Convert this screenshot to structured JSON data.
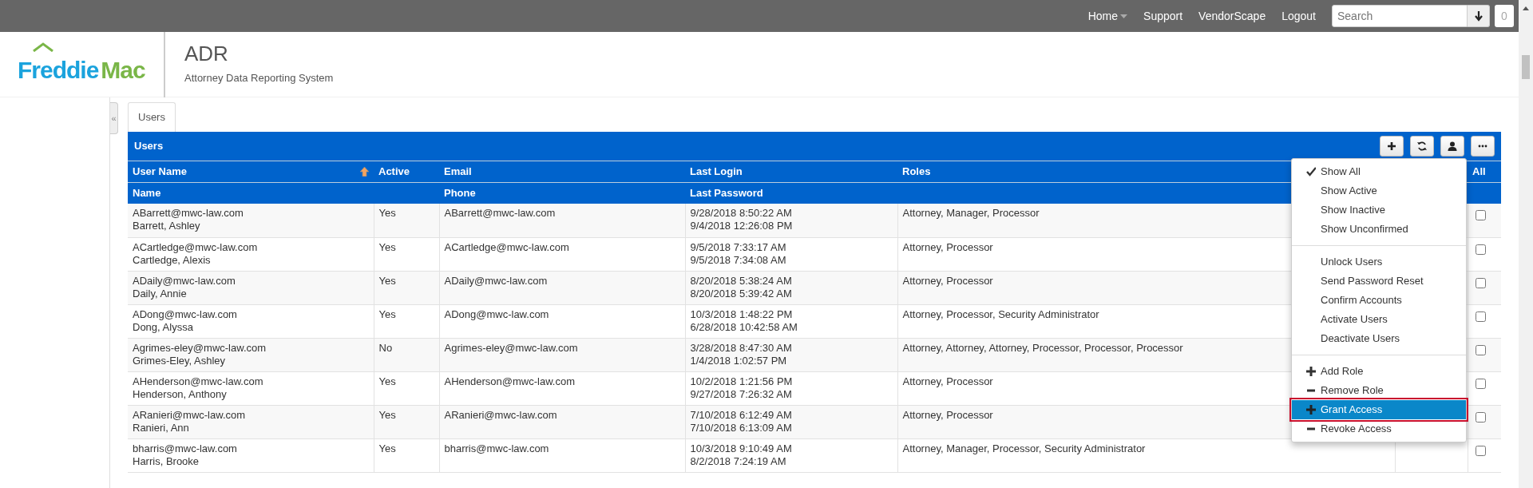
{
  "top_nav": {
    "links": [
      {
        "label": "Home",
        "has_caret": true
      },
      {
        "label": "Support",
        "has_caret": false
      },
      {
        "label": "VendorScape",
        "has_caret": false
      },
      {
        "label": "Logout",
        "has_caret": false
      }
    ],
    "search": {
      "placeholder": "Search"
    },
    "badge": "0"
  },
  "header": {
    "logo": [
      "Freddie",
      "Mac"
    ],
    "title": "ADR",
    "subtitle": "Attorney Data Reporting System"
  },
  "sidebar_toggle": "«",
  "tabs": [
    {
      "label": "Users",
      "selected": true
    }
  ],
  "panel": {
    "title": "Users",
    "toolbar": [
      {
        "kind": "plus"
      },
      {
        "kind": "refresh"
      },
      {
        "kind": "user"
      },
      {
        "kind": "more"
      }
    ]
  },
  "table": {
    "columns": [
      {
        "label": "User Name",
        "sorted_ascending": true
      },
      {
        "label": "Active"
      },
      {
        "label": "Email"
      },
      {
        "label": "Last Login"
      },
      {
        "label": "Roles"
      },
      {},
      {
        "label": "All"
      }
    ],
    "sub_columns": [
      "Name",
      "",
      "Phone",
      "Last Password"
    ],
    "rows": [
      {
        "user_name": "ABarrett@mwc-law.com",
        "name": "Barrett, Ashley",
        "active": "Yes",
        "email": "ABarrett@mwc-law.com",
        "last_login": "9/28/2018 8:50:22 AM",
        "last_password": "9/4/2018 12:26:08 PM",
        "roles": "Attorney, Manager, Processor",
        "checked": false
      },
      {
        "user_name": "ACartledge@mwc-law.com",
        "name": "Cartledge, Alexis",
        "active": "Yes",
        "email": "ACartledge@mwc-law.com",
        "last_login": "9/5/2018 7:33:17 AM",
        "last_password": "9/5/2018 7:34:08 AM",
        "roles": "Attorney, Processor",
        "checked": false
      },
      {
        "user_name": "ADaily@mwc-law.com",
        "name": "Daily, Annie",
        "active": "Yes",
        "email": "ADaily@mwc-law.com",
        "last_login": "8/20/2018 5:38:24 AM",
        "last_password": "8/20/2018 5:39:42 AM",
        "roles": "Attorney, Processor",
        "checked": false
      },
      {
        "user_name": "ADong@mwc-law.com",
        "name": "Dong, Alyssa",
        "active": "Yes",
        "email": "ADong@mwc-law.com",
        "last_login": "10/3/2018 1:48:22 PM",
        "last_password": "6/28/2018 10:42:58 AM",
        "roles": "Attorney, Processor, Security Administrator",
        "checked": false
      },
      {
        "user_name": "Agrimes-eley@mwc-law.com",
        "name": "Grimes-Eley, Ashley",
        "active": "No",
        "email": "Agrimes-eley@mwc-law.com",
        "last_login": "3/28/2018 8:47:30 AM",
        "last_password": "1/4/2018 1:02:57 PM",
        "roles": "Attorney, Attorney, Attorney, Processor, Processor, Processor",
        "checked": false
      },
      {
        "user_name": "AHenderson@mwc-law.com",
        "name": "Henderson, Anthony",
        "active": "Yes",
        "email": "AHenderson@mwc-law.com",
        "last_login": "10/2/2018 1:21:56 PM",
        "last_password": "9/27/2018 7:26:32 AM",
        "roles": "Attorney, Processor",
        "checked": false
      },
      {
        "user_name": "ARanieri@mwc-law.com",
        "name": "Ranieri, Ann",
        "active": "Yes",
        "email": "ARanieri@mwc-law.com",
        "last_login": "7/10/2018 6:12:49 AM",
        "last_password": "7/10/2018 6:13:09 AM",
        "roles": "Attorney, Processor",
        "checked": false
      },
      {
        "user_name": "bharris@mwc-law.com",
        "name": "Harris, Brooke",
        "active": "Yes",
        "email": "bharris@mwc-law.com",
        "last_login": "10/3/2018 9:10:49 AM",
        "last_password": "8/2/2018 7:24:19 AM",
        "roles": "Attorney, Manager, Processor, Security Administrator",
        "checked": false
      }
    ]
  },
  "menu": {
    "groups": [
      [
        {
          "label": "Show All",
          "kind": "check",
          "checked": true,
          "selected": false
        },
        {
          "label": "Show Active",
          "kind": "check",
          "checked": false,
          "selected": false
        },
        {
          "label": "Show Inactive",
          "kind": "check",
          "checked": false,
          "selected": false
        },
        {
          "label": "Show Unconfirmed",
          "kind": "check",
          "checked": false,
          "selected": false
        }
      ],
      [
        {
          "label": "Unlock Users",
          "kind": "plain",
          "selected": false
        },
        {
          "label": "Send Password Reset",
          "kind": "plain",
          "selected": false
        },
        {
          "label": "Confirm Accounts",
          "kind": "plain",
          "selected": false
        },
        {
          "label": "Activate Users",
          "kind": "plain",
          "selected": false
        },
        {
          "label": "Deactivate Users",
          "kind": "plain",
          "selected": false
        }
      ],
      [
        {
          "label": "Add Role",
          "kind": "plus",
          "selected": false
        },
        {
          "label": "Remove Role",
          "kind": "minus",
          "selected": false
        },
        {
          "label": "Grant Access",
          "kind": "plus",
          "selected": true
        },
        {
          "label": "Revoke Access",
          "kind": "minus",
          "selected": false
        }
      ]
    ]
  }
}
